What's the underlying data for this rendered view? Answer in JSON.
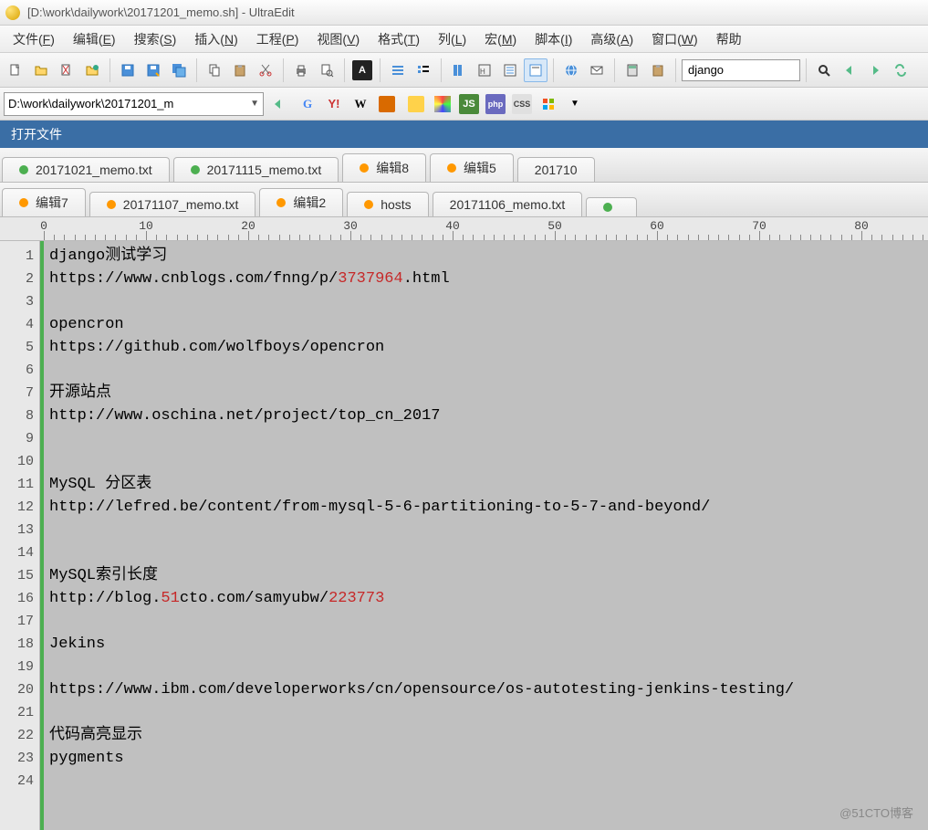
{
  "window": {
    "title": "[D:\\work\\dailywork\\20171201_memo.sh] - UltraEdit"
  },
  "menus": [
    {
      "label": "文件",
      "key": "F"
    },
    {
      "label": "编辑",
      "key": "E"
    },
    {
      "label": "搜索",
      "key": "S"
    },
    {
      "label": "插入",
      "key": "N"
    },
    {
      "label": "工程",
      "key": "P"
    },
    {
      "label": "视图",
      "key": "V"
    },
    {
      "label": "格式",
      "key": "T"
    },
    {
      "label": "列",
      "key": "L"
    },
    {
      "label": "宏",
      "key": "M"
    },
    {
      "label": "脚本",
      "key": "I"
    },
    {
      "label": "高级",
      "key": "A"
    },
    {
      "label": "窗口",
      "key": "W"
    },
    {
      "label": "帮助",
      "key": ""
    }
  ],
  "toolbar": {
    "search_value": "django"
  },
  "toolbar2": {
    "path": "D:\\work\\dailywork\\20171201_m"
  },
  "open_files_label": "打开文件",
  "tabs_row1": [
    {
      "dot": "green",
      "label": "20171021_memo.txt"
    },
    {
      "dot": "green",
      "label": "20171115_memo.txt"
    },
    {
      "dot": "orange",
      "label": "编辑8"
    },
    {
      "dot": "orange",
      "label": "编辑5"
    },
    {
      "dot": "",
      "label": "201710"
    }
  ],
  "tabs_row2": [
    {
      "dot": "orange",
      "label": "编辑7"
    },
    {
      "dot": "orange",
      "label": "20171107_memo.txt"
    },
    {
      "dot": "orange",
      "label": "编辑2"
    },
    {
      "dot": "orange",
      "label": "hosts"
    },
    {
      "dot": "",
      "label": "20171106_memo.txt"
    },
    {
      "dot": "green",
      "label": ""
    }
  ],
  "ruler_labels": [
    "0",
    "10",
    "20",
    "30",
    "40",
    "50",
    "60",
    "70",
    "80"
  ],
  "code_lines": [
    {
      "n": 1,
      "t": "django测试学习"
    },
    {
      "n": 2,
      "t": "https://www.cnblogs.com/fnng/p/<span class='num'>3737964</span>.html"
    },
    {
      "n": 3,
      "t": ""
    },
    {
      "n": 4,
      "t": "opencron"
    },
    {
      "n": 5,
      "t": "https://github.com/wolfboys/opencron"
    },
    {
      "n": 6,
      "t": ""
    },
    {
      "n": 7,
      "t": "开源站点"
    },
    {
      "n": 8,
      "t": "http://www.oschina.net/project/top_cn_2017"
    },
    {
      "n": 9,
      "t": ""
    },
    {
      "n": 10,
      "t": ""
    },
    {
      "n": 11,
      "t": "MySQL 分区表"
    },
    {
      "n": 12,
      "t": "http://lefred.be/content/from-mysql-5-6-partitioning-to-5-7-and-beyond/"
    },
    {
      "n": 13,
      "t": ""
    },
    {
      "n": 14,
      "t": ""
    },
    {
      "n": 15,
      "t": "MySQL索引长度"
    },
    {
      "n": 16,
      "t": "http://blog.<span class='num'>51</span>cto.com/samyubw/<span class='num'>223773</span>"
    },
    {
      "n": 17,
      "t": ""
    },
    {
      "n": 18,
      "t": "Jekins"
    },
    {
      "n": 19,
      "t": ""
    },
    {
      "n": 20,
      "t": "https://www.ibm.com/developerworks/cn/opensource/os-autotesting-jenkins-testing/"
    },
    {
      "n": 21,
      "t": ""
    },
    {
      "n": 22,
      "t": "代码高亮显示"
    },
    {
      "n": 23,
      "t": "pygments"
    },
    {
      "n": 24,
      "t": ""
    }
  ],
  "watermark": "@51CTO博客"
}
